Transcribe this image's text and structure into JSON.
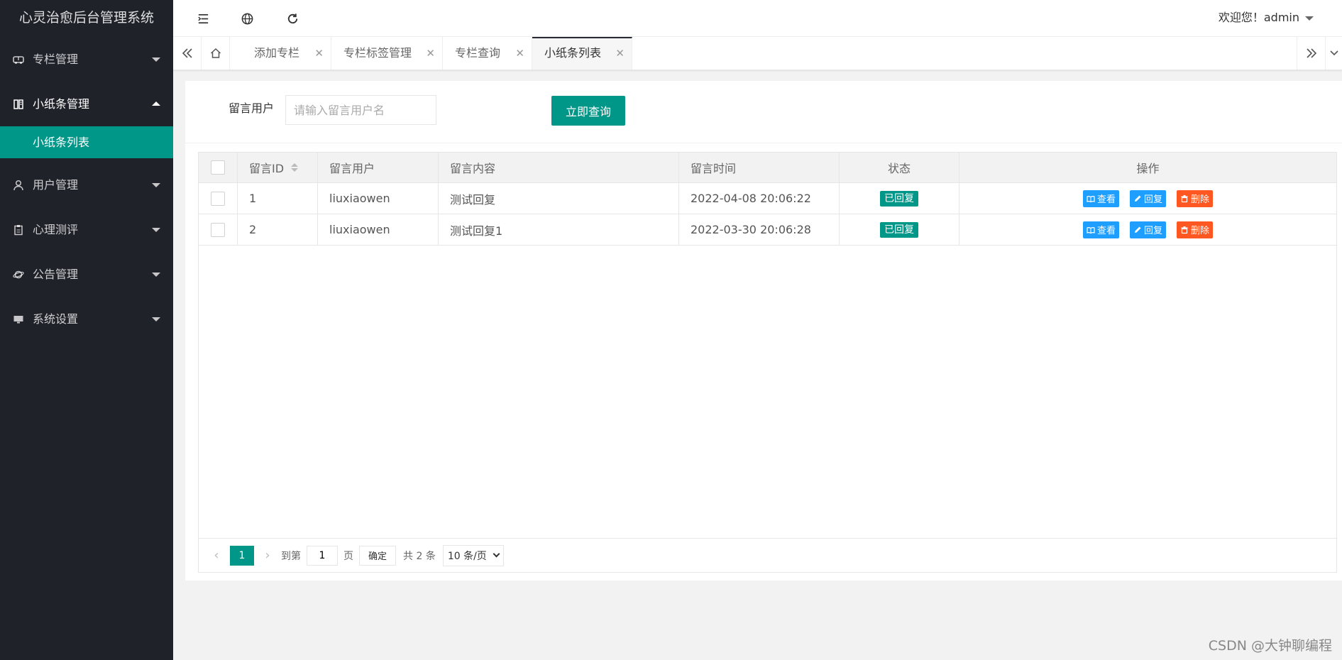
{
  "app": {
    "title": "心灵治愈后台管理系统"
  },
  "sidebar": {
    "items": [
      {
        "label": "专栏管理",
        "icon": "bus-icon"
      },
      {
        "label": "小纸条管理",
        "icon": "book-icon"
      },
      {
        "label": "用户管理",
        "icon": "user-icon"
      },
      {
        "label": "心理测评",
        "icon": "clipboard-icon"
      },
      {
        "label": "公告管理",
        "icon": "planet-icon"
      },
      {
        "label": "系统设置",
        "icon": "monitor-icon"
      }
    ],
    "sub_item": "小纸条列表"
  },
  "header": {
    "user_text": "欢迎您！admin"
  },
  "tabs": [
    {
      "label": "添加专栏"
    },
    {
      "label": "专栏标签管理"
    },
    {
      "label": "专栏查询"
    },
    {
      "label": "小纸条列表"
    }
  ],
  "search": {
    "label": "留言用户",
    "placeholder": "请输入留言用户名",
    "button": "立即查询"
  },
  "table": {
    "headers": [
      "留言ID",
      "留言用户",
      "留言内容",
      "留言时间",
      "状态",
      "操作"
    ],
    "rows": [
      {
        "id": "1",
        "user": "liuxiaowen",
        "content": "测试回复",
        "time": "2022-04-08 20:06:22",
        "status": "已回复"
      },
      {
        "id": "2",
        "user": "liuxiaowen",
        "content": "测试回复1",
        "time": "2022-03-30 20:06:28",
        "status": "已回复"
      }
    ],
    "actions": {
      "view": "查看",
      "reply": "回复",
      "delete": "删除"
    }
  },
  "pager": {
    "current": "1",
    "goto_label": "到第",
    "page_input": "1",
    "page_unit": "页",
    "confirm": "确定",
    "total": "共 2 条",
    "per_page": "10 条/页"
  },
  "watermark": "CSDN @大钟聊编程",
  "colors": {
    "primary": "#009688",
    "sidebar": "#20222a",
    "blue": "#1e9fff",
    "red": "#ff5722"
  }
}
